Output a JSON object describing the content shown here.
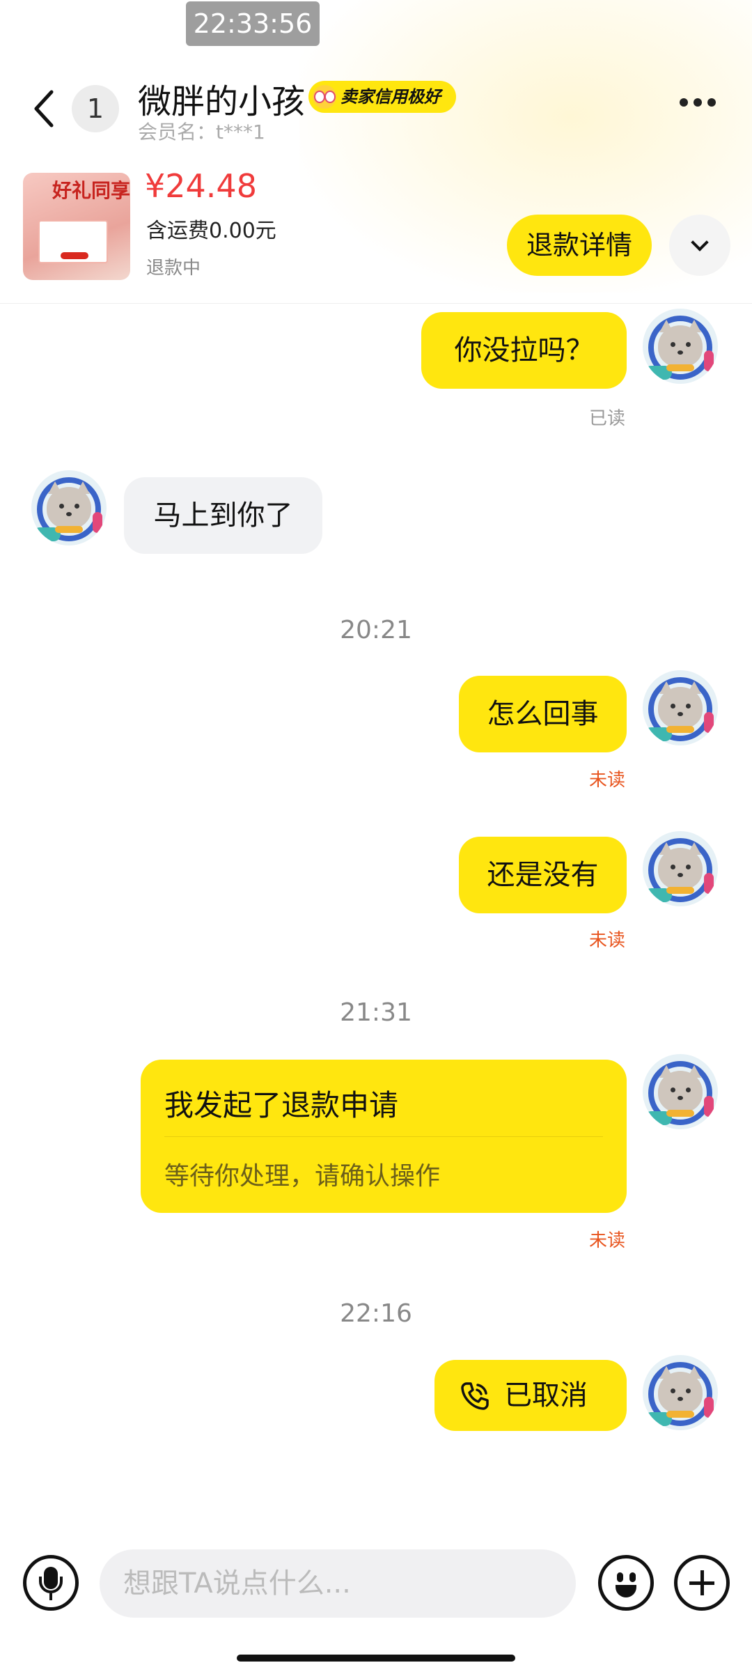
{
  "status_bar": {
    "time": "22:33:56"
  },
  "header": {
    "unread_count": "1",
    "shop_name": "微胖的小孩",
    "credit_badge": "卖家信用极好",
    "member_id": "会员名：t***1"
  },
  "order": {
    "thumb_text": "好礼同享",
    "price": "¥24.48",
    "shipping": "含运费0.00元",
    "status": "退款中",
    "refund_detail_label": "退款详情"
  },
  "messages": [
    {
      "text": "你没拉吗？",
      "receipt": "已读"
    },
    {
      "text": "马上到你了"
    },
    {
      "time": "20:21"
    },
    {
      "text": "怎么回事",
      "receipt": "未读"
    },
    {
      "text": "还是没有",
      "receipt": "未读"
    },
    {
      "time": "21:31"
    },
    {
      "title": "我发起了退款申请",
      "subtitle": "等待你处理，请确认操作",
      "receipt": "未读"
    },
    {
      "time": "22:16"
    },
    {
      "text": "已取消"
    }
  ],
  "input_bar": {
    "placeholder": "想跟TA说点什么..."
  },
  "colors": {
    "accent": "#ffe60f",
    "price": "#f03b3b",
    "unread": "#e8551f"
  }
}
